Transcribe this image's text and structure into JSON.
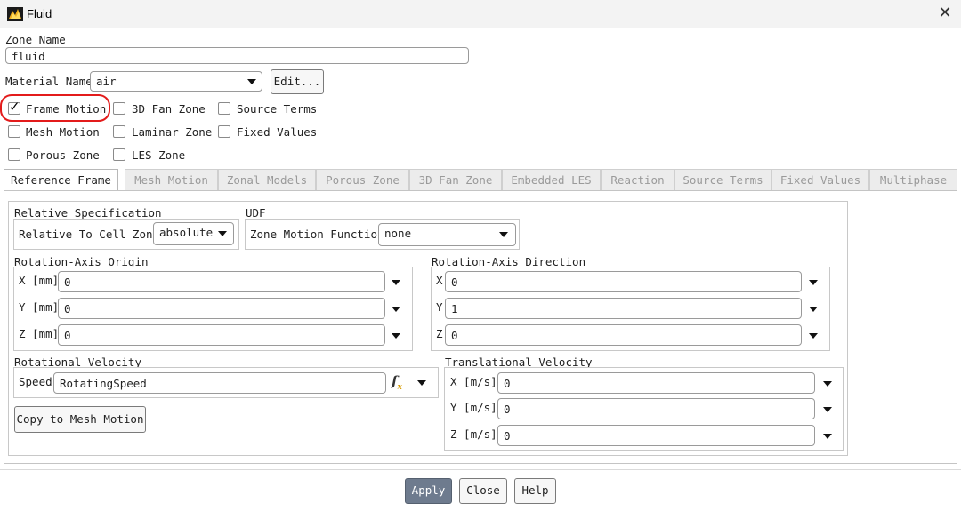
{
  "window": {
    "title": "Fluid",
    "close_icon": "✕"
  },
  "zone_name": {
    "label": "Zone Name",
    "value": "fluid"
  },
  "material": {
    "label": "Material Name",
    "value": "air",
    "edit_label": "Edit..."
  },
  "options": {
    "frame_motion": {
      "label": "Frame Motion",
      "checked": true
    },
    "fan_zone_3d": {
      "label": "3D Fan Zone",
      "checked": false
    },
    "source_terms": {
      "label": "Source Terms",
      "checked": false
    },
    "mesh_motion": {
      "label": "Mesh Motion",
      "checked": false
    },
    "laminar_zone": {
      "label": "Laminar Zone",
      "checked": false
    },
    "fixed_values": {
      "label": "Fixed Values",
      "checked": false
    },
    "porous_zone": {
      "label": "Porous Zone",
      "checked": false
    },
    "les_zone": {
      "label": "LES Zone",
      "checked": false
    }
  },
  "tabs": [
    {
      "label": "Reference Frame",
      "active": true
    },
    {
      "label": "Mesh Motion",
      "active": false
    },
    {
      "label": "Zonal Models",
      "active": false
    },
    {
      "label": "Porous Zone",
      "active": false
    },
    {
      "label": "3D Fan Zone",
      "active": false
    },
    {
      "label": "Embedded LES",
      "active": false
    },
    {
      "label": "Reaction",
      "active": false
    },
    {
      "label": "Source Terms",
      "active": false
    },
    {
      "label": "Fixed Values",
      "active": false
    },
    {
      "label": "Multiphase",
      "active": false
    }
  ],
  "relative_spec": {
    "title": "Relative Specification",
    "label": "Relative To Cell Zone",
    "value": "absolute"
  },
  "udf": {
    "title": "UDF",
    "label": "Zone Motion Function",
    "value": "none"
  },
  "axis_origin": {
    "title": "Rotation-Axis Origin",
    "x_label": "X [mm]",
    "x_value": "0",
    "y_label": "Y [mm]",
    "y_value": "0",
    "z_label": "Z [mm]",
    "z_value": "0"
  },
  "axis_direction": {
    "title": "Rotation-Axis Direction",
    "x_label": "X",
    "x_value": "0",
    "y_label": "Y",
    "y_value": "1",
    "z_label": "Z",
    "z_value": "0"
  },
  "rotational_velocity": {
    "title": "Rotational Velocity",
    "speed_label": "Speed",
    "speed_value": "RotatingSpeed",
    "copy_label": "Copy to Mesh Motion"
  },
  "translational_velocity": {
    "title": "Translational Velocity",
    "x_label": "X [m/s]",
    "x_value": "0",
    "y_label": "Y [m/s]",
    "y_value": "0",
    "z_label": "Z [m/s]",
    "z_value": "0"
  },
  "buttons": {
    "apply": "Apply",
    "close": "Close",
    "help": "Help"
  },
  "colors": {
    "highlight": "#e31b1b",
    "apply_bg": "#6e7b8e"
  }
}
